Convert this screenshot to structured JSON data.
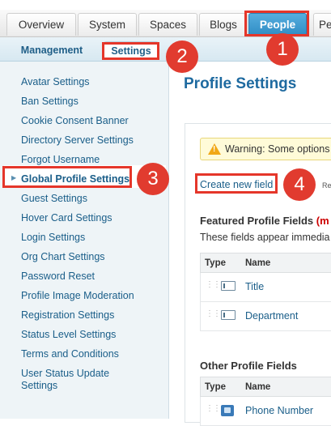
{
  "tabs": [
    "Overview",
    "System",
    "Spaces",
    "Blogs",
    "People",
    "Pe"
  ],
  "active_tab": "People",
  "subtabs": [
    "Management",
    "Settings"
  ],
  "active_subtab": "Settings",
  "sidebar": {
    "items": [
      "Avatar Settings",
      "Ban Settings",
      "Cookie Consent Banner",
      "Directory Server Settings",
      "Forgot Username",
      "Global Profile Settings",
      "Guest Settings",
      "Hover Card Settings",
      "Login Settings",
      "Org Chart Settings",
      "Password Reset",
      "Profile Image Moderation",
      "Registration Settings",
      "Status Level Settings",
      "Terms and Conditions",
      "User Status Update",
      "Settings"
    ],
    "active_item": "Global Profile Settings"
  },
  "main": {
    "title": "Profile Settings",
    "warning_text": "Warning: Some options",
    "create_link": "Create new field",
    "create_trailing": "Re",
    "featured": {
      "title": "Featured Profile Fields",
      "title_suffix": "(m",
      "description": "These fields appear immedia",
      "col_type": "Type",
      "col_name": "Name",
      "rows": [
        "Title",
        "Department"
      ]
    },
    "other": {
      "title": "Other Profile Fields",
      "col_type": "Type",
      "col_name": "Name",
      "rows": [
        "Phone Number"
      ]
    }
  },
  "callouts": [
    "1",
    "2",
    "3",
    "4"
  ],
  "colors": {
    "active_tab": "#3b97cf",
    "highlight": "#e5362a",
    "link": "#1a5e89",
    "title": "#1e6aa0"
  }
}
